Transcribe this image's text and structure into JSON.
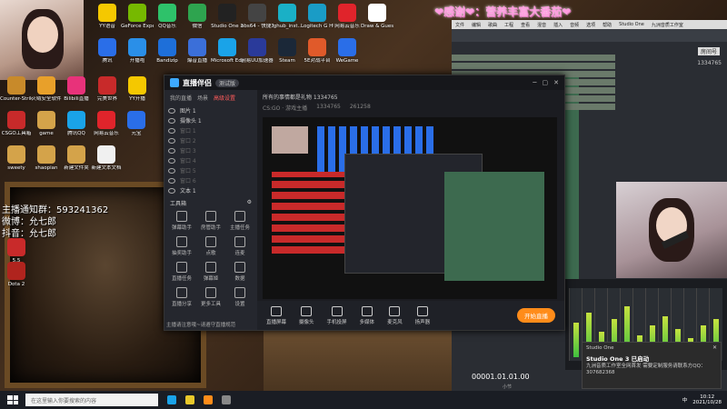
{
  "desktop": {
    "icons": [
      {
        "label": "YY语音",
        "color": "#f5c800"
      },
      {
        "label": "GeForce Experience",
        "color": "#76b900"
      },
      {
        "label": "QQ音乐",
        "color": "#2ec26a"
      },
      {
        "label": "微信",
        "color": "#2ea44f"
      },
      {
        "label": "Studio One 3",
        "color": "#222"
      },
      {
        "label": "obs64 - 快捷方式",
        "color": "#444"
      },
      {
        "label": "lghub_inst...",
        "color": "#1ab0c6"
      },
      {
        "label": "Logitech G HUB",
        "color": "#1a9cc6"
      },
      {
        "label": "网易云音乐",
        "color": "#e0242b"
      },
      {
        "label": "Draw & Guess",
        "color": "#ffffff"
      },
      {
        "label": "腾讯",
        "color": "#2a6ee8"
      },
      {
        "label": "开播啦",
        "color": "#2a8fe8"
      },
      {
        "label": "Bandizip",
        "color": "#1e6fd9"
      },
      {
        "label": "爆音直播",
        "color": "#3b6fd9"
      },
      {
        "label": "Microsoft Edge",
        "color": "#1aa3e8"
      },
      {
        "label": "网易UU加速器",
        "color": "#2a3a9a"
      },
      {
        "label": "Steam",
        "color": "#1b2838"
      },
      {
        "label": "5E对战平台",
        "color": "#e05a2a"
      },
      {
        "label": "WeGame",
        "color": "#2a6ee8"
      },
      {
        "label": "Counter-Strike Global Of...",
        "color": "#c88a2a"
      },
      {
        "label": "火绒安全软件",
        "color": "#e8a02a"
      },
      {
        "label": "Bilibili直播",
        "color": "#e8327a"
      },
      {
        "label": "完美世界",
        "color": "#c82a2a"
      },
      {
        "label": "YY开播",
        "color": "#f5c800"
      },
      {
        "label": "CSGO工具箱",
        "color": "#c82a2a"
      },
      {
        "label": "game",
        "color": "#d4a34a"
      },
      {
        "label": "腾讯QQ",
        "color": "#1aa3e8"
      },
      {
        "label": "网易云音乐",
        "color": "#e0242b"
      },
      {
        "label": "元宝",
        "color": "#2a6ee8"
      },
      {
        "label": "sweety",
        "color": "#d4a34a"
      },
      {
        "label": "shaopian",
        "color": "#d4a34a"
      },
      {
        "label": "新建文件夹",
        "color": "#d4a34a"
      },
      {
        "label": "新建文本文档",
        "color": "#f0f0f0"
      },
      {
        "label": "5.5",
        "color": "#c82a2a"
      },
      {
        "label": "Dota 2",
        "color": "#b0241e"
      }
    ]
  },
  "overlay": {
    "banner": "❤感谢❤：营养丰富大番茄❤",
    "fan_group": "主播通知群：593241362",
    "weibo": "微博：允七郎",
    "douyin": "抖音：允七郎"
  },
  "app": {
    "title": "直播伴侣",
    "badge": "测试版",
    "side_tabs": [
      "我的直播",
      "场景",
      "高级设置"
    ],
    "scenes": [
      {
        "label": "图片 1",
        "dim": false
      },
      {
        "label": "摄像头 1",
        "dim": false
      },
      {
        "label": "窗口 1",
        "dim": true
      },
      {
        "label": "窗口 2",
        "dim": true
      },
      {
        "label": "窗口 3",
        "dim": true
      },
      {
        "label": "窗口 4",
        "dim": true
      },
      {
        "label": "窗口 5",
        "dim": true
      },
      {
        "label": "窗口 6",
        "dim": true
      },
      {
        "label": "文本 1",
        "dim": false
      }
    ],
    "tools_header": "工具箱",
    "tools": [
      "弹幕助手",
      "房管助手",
      "主播任务",
      "抽奖助手",
      "点歌",
      "连麦",
      "直播任务",
      "弹幕姬",
      "数据",
      "直播分享",
      "更多工具",
      "设置"
    ],
    "stream_title": "所有的事情都是礼物 1334765",
    "stream_tag": "CS:GO · 游戏主播",
    "stream_stats": [
      "1334765",
      "261258"
    ],
    "footer_notice": "主播请注意哦~请遵守直播规范",
    "bottom_buttons": [
      "直播屏幕",
      "摄像头",
      "手机投屏",
      "多媒体",
      "麦克风",
      "扬声器"
    ],
    "go_live": "开始直播"
  },
  "daw": {
    "menu": [
      "文件",
      "编辑",
      "歌曲",
      "工程",
      "查看",
      "混音",
      "插入",
      "音频",
      "选项",
      "帮助",
      "Studio One",
      "九洲音质工作室"
    ],
    "room_label": "房间号",
    "room_number": "1334765",
    "transport_time": "00001.01.01.00",
    "transport_label": "小节"
  },
  "popup": {
    "app": "Studio One",
    "title": "Studio One 3 已启动",
    "body": "九洲音质工作室全网首发 需要定制服务请联系方QQ：307682368",
    "close": "✕"
  },
  "taskbar": {
    "search_placeholder": "在这里输入你要搜索的内容",
    "time": "10:12",
    "date": "2021/10/28",
    "lang": "中"
  }
}
